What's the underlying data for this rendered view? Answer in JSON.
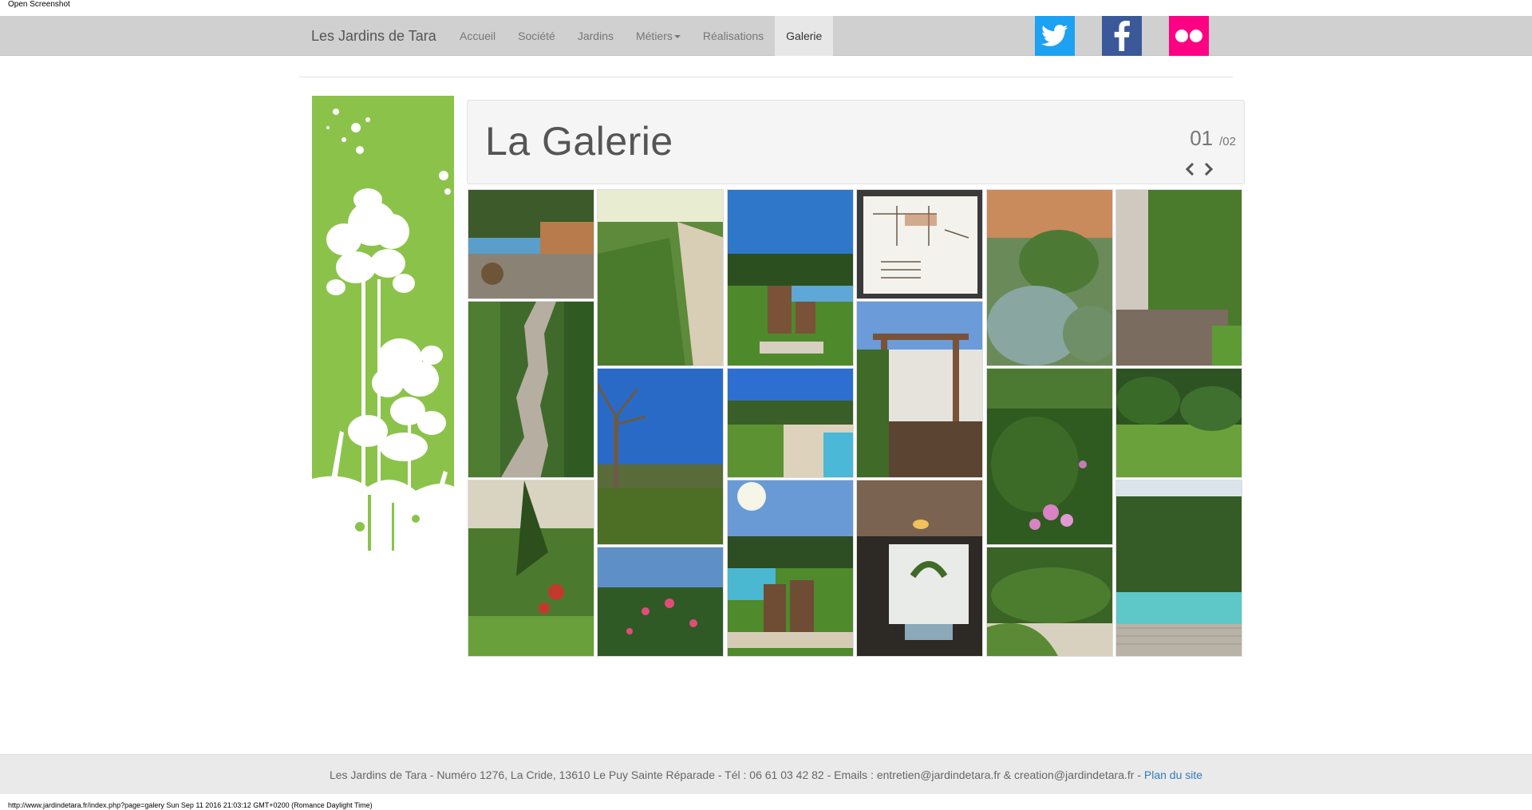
{
  "window": {
    "label": "Open Screenshot"
  },
  "nav": {
    "brand": "Les Jardins de Tara",
    "items": [
      {
        "label": "Accueil",
        "active": false,
        "dropdown": false
      },
      {
        "label": "Société",
        "active": false,
        "dropdown": false
      },
      {
        "label": "Jardins",
        "active": false,
        "dropdown": false
      },
      {
        "label": "Métiers",
        "active": false,
        "dropdown": true
      },
      {
        "label": "Réalisations",
        "active": false,
        "dropdown": false
      },
      {
        "label": "Galerie",
        "active": true,
        "dropdown": false
      }
    ],
    "social": [
      {
        "name": "twitter-icon",
        "color": "#1da1f2"
      },
      {
        "name": "facebook-icon",
        "color": "#3b5998"
      },
      {
        "name": "flickr-icon",
        "color": "#ff0084"
      }
    ]
  },
  "gallery": {
    "title": "La Galerie",
    "page_current": "01",
    "page_total": "/02",
    "photos": [
      "pool-with-wooden-deck",
      "stone-steps-path",
      "garden-flowering-border",
      "iris-leaves-bed",
      "lawn-with-bare-tree",
      "pink-oleander-shrub",
      "potted-palms-by-pool",
      "lawn-and-pool-deck",
      "potted-palms-sunny-pool",
      "pergola-sketch-drawing",
      "wooden-pergola-terrace",
      "reed-shade-pergola",
      "grasses-and-euphorbia",
      "pink-flowers-border",
      "trimmed-hedge-gravel",
      "bamboo-screen-deck",
      "green-lawn-garden",
      "pool-with-wood-deck-garden"
    ]
  },
  "footer": {
    "text": "Les Jardins de Tara - Numéro 1276, La Cride, 13610 Le Puy Sainte Réparade - Tél : 06 61 03 42 82 - Emails : entretien@jardindetara.fr & creation@jardindetara.fr - ",
    "link": "Plan du site"
  },
  "status_bar": "http://www.jardindetara.fr/index.php?page=galery Sun Sep 11 2016 21:03:12 GMT+0200 (Romance Daylight Time)"
}
